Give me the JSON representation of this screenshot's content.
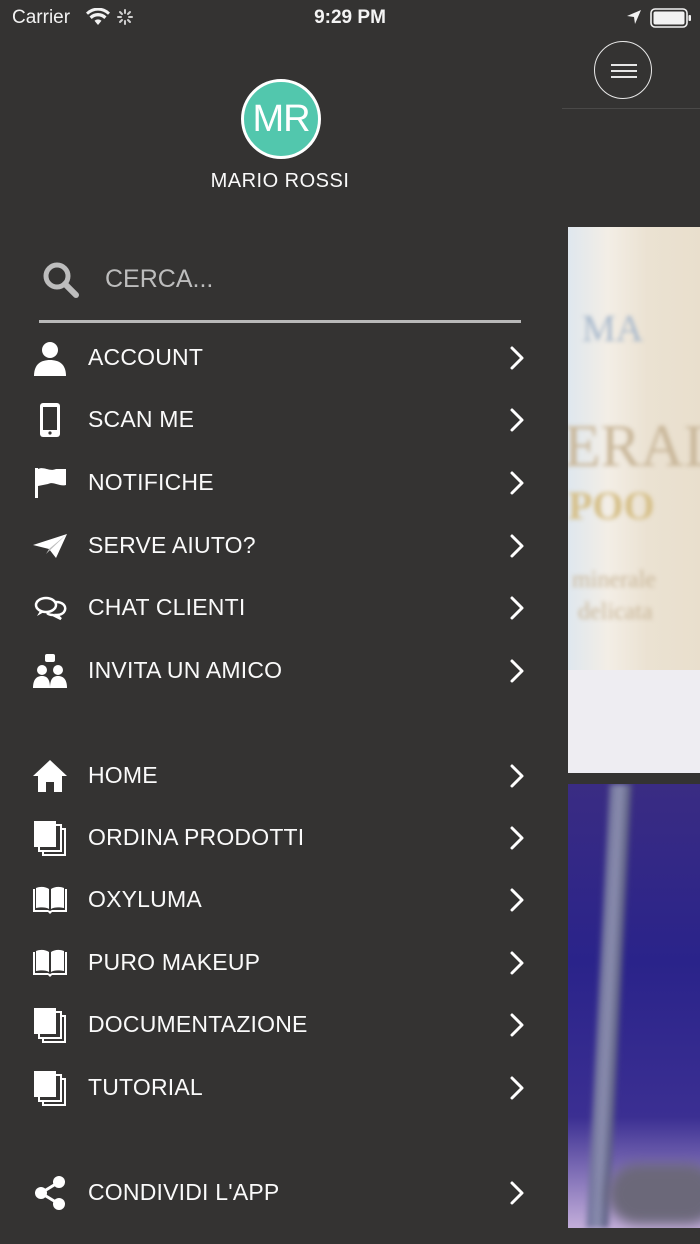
{
  "status_bar": {
    "carrier": "Carrier",
    "time": "9:29 PM"
  },
  "profile": {
    "initials": "MR",
    "name": "MARIO ROSSI",
    "avatar_color": "#52c7ad"
  },
  "search": {
    "placeholder": "CERCA..."
  },
  "menu_group_1": [
    {
      "label": "ACCOUNT",
      "icon": "user-icon"
    },
    {
      "label": "SCAN ME",
      "icon": "phone-icon"
    },
    {
      "label": "NOTIFICHE",
      "icon": "flag-icon"
    },
    {
      "label": "SERVE AIUTO?",
      "icon": "paper-plane-icon"
    },
    {
      "label": "CHAT CLIENTI",
      "icon": "chat-icon"
    },
    {
      "label": "INVITA UN AMICO",
      "icon": "invite-friends-icon"
    }
  ],
  "menu_group_2": [
    {
      "label": "HOME",
      "icon": "home-icon"
    },
    {
      "label": "ORDINA PRODOTTI",
      "icon": "documents-icon"
    },
    {
      "label": "OXYLUMA",
      "icon": "book-icon"
    },
    {
      "label": "PURO MAKEUP",
      "icon": "book-icon"
    },
    {
      "label": "DOCUMENTAZIONE",
      "icon": "documents-icon"
    },
    {
      "label": "TUTORIAL",
      "icon": "documents-icon"
    }
  ],
  "menu_group_3": [
    {
      "label": "CONDIVIDI L'APP",
      "icon": "share-icon"
    }
  ],
  "colors": {
    "background": "#343332",
    "text": "#fafafa",
    "accent": "#52c7ad"
  }
}
